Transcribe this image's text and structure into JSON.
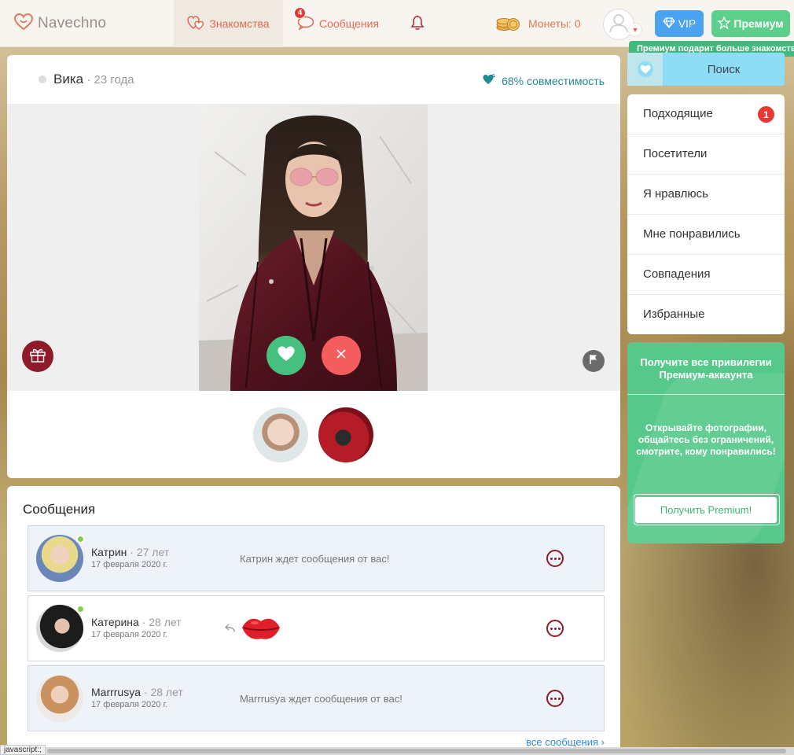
{
  "header": {
    "logo_text": "Navechno",
    "nav": {
      "dating": "Знакомства",
      "messages": "Сообщения",
      "messages_badge": "4",
      "coins": "Монеты: 0"
    },
    "vip_label": "VIP",
    "premium_label": "Премиум",
    "tooltip": "Премиум подарит больше знакомств"
  },
  "profile": {
    "name": "Вика",
    "separator": " · ",
    "age": "23 года",
    "compatibility": "68% совместимость"
  },
  "messages": {
    "title": "Сообщения",
    "items": [
      {
        "name": "Катрин",
        "age": "· 27 лет",
        "date": "17 февраля 2020 г.",
        "text": "Катрин ждет сообщения от вас!",
        "online": true
      },
      {
        "name": "Катерина",
        "age": "· 28 лет",
        "date": "17 февраля 2020 г.",
        "text": "",
        "online": true
      },
      {
        "name": "Marrrusya",
        "age": "· 28 лет",
        "date": "17 февраля 2020 г.",
        "text": "Marrrusya ждет сообщения от вас!",
        "online": false
      }
    ],
    "all_link": "все сообщения"
  },
  "sidebar": {
    "search_label": "Поиск",
    "menu": [
      {
        "label": "Подходящие",
        "badge": "1"
      },
      {
        "label": "Посетители"
      },
      {
        "label": "Я нравлюсь"
      },
      {
        "label": "Мне понравились"
      },
      {
        "label": "Совпадения"
      },
      {
        "label": "Избранные"
      }
    ],
    "promo": {
      "title": "Получите все привилегии Премиум-аккаунта",
      "text": "Открывайте фотографии, общайтесь без ограничений, смотрите, кому понравились!",
      "button": "Получить Premium!"
    }
  },
  "statusbar": {
    "text": "javascript:;"
  },
  "colors": {
    "brand": "#e06a4f",
    "like": "#45c07f",
    "dislike": "#f45d5d",
    "premium": "#56c98a",
    "vip": "#4aa3f0",
    "accent_dark": "#8e1a2a"
  },
  "icons": [
    "heart-logo-icon",
    "hearts-icon",
    "chat-icon",
    "bell-icon",
    "coins-icon",
    "user-icon",
    "diamond-icon",
    "star-icon",
    "heart-compat-icon",
    "gift-icon",
    "heart-icon",
    "close-icon",
    "flag-icon",
    "reply-icon",
    "lips-sticker-icon",
    "more-icon",
    "chevron-right-icon"
  ]
}
